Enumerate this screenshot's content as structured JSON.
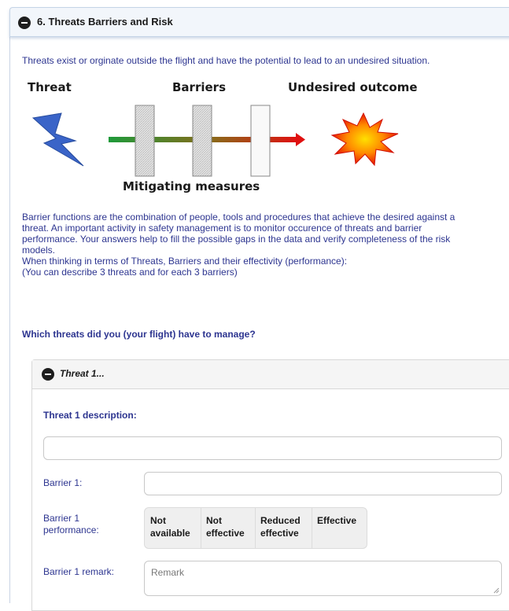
{
  "section": {
    "title": "6. Threats Barriers and Risk"
  },
  "intro": "Threats exist or orginate outside the flight and have the potential to lead to an undesired situation.",
  "diagram": {
    "threat_label": "Threat",
    "barriers_label": "Barriers",
    "outcome_label": "Undesired outcome",
    "measures_label": "Mitigating measures"
  },
  "paragraph": {
    "line1": "Barrier functions are the combination of people, tools and procedures that achieve the desired against a",
    "line2": "threat. An important activity in safety management is to monitor occurence of threats and barrier",
    "line3": "performance. Your answers help to fill the possible gaps in the data and verify completeness of the risk",
    "line4": "models.",
    "line5": "When thinking in terms of Threats, Barriers and their effectivity (performance):",
    "line6": "(You can describe 3 threats and for each 3 barriers)"
  },
  "question": "Which threats did you (your flight) have to manage?",
  "threat1": {
    "title": "Threat 1...",
    "description_label": "Threat 1 description:",
    "description_value": "",
    "barrier1_label": "Barrier 1:",
    "barrier1_value": "",
    "performance_label_line1": "Barrier 1",
    "performance_label_line2": "performance:",
    "performance_options": [
      {
        "line1": "Not",
        "line2": "available"
      },
      {
        "line1": "Not",
        "line2": "effective"
      },
      {
        "line1": "Reduced",
        "line2": "effective"
      },
      {
        "line1": "Effective",
        "line2": ""
      }
    ],
    "remark_label": "Barrier 1 remark:",
    "remark_placeholder": "Remark"
  },
  "colors": {
    "text_blue": "#2d3590",
    "header_bg": "#f2f6fb",
    "arrow_start": "#1e9a3a",
    "arrow_end": "#e01010"
  },
  "icons": {
    "collapse": "minus-circle-icon",
    "threat": "lightning-icon",
    "outcome": "explosion-icon",
    "resize": "resize-grip-icon"
  }
}
